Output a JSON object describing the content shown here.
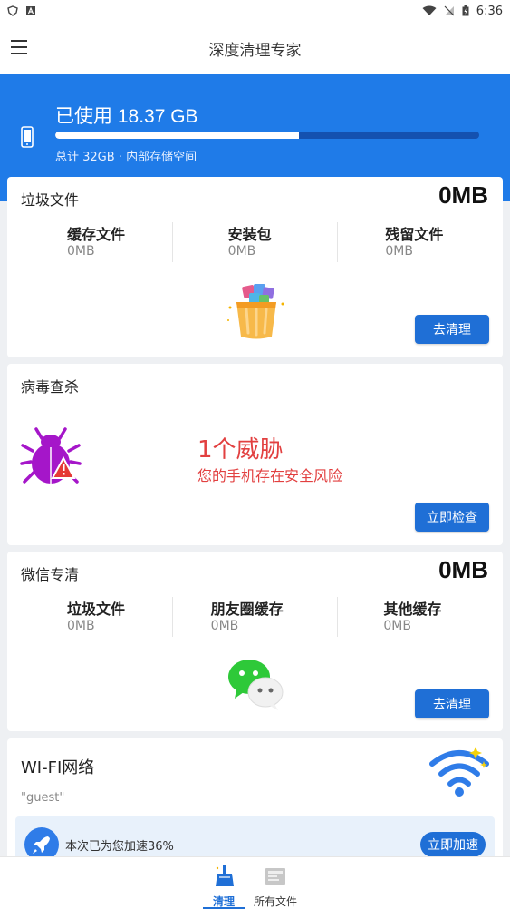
{
  "status_bar": {
    "time": "6:36"
  },
  "app_bar": {
    "title": "深度清理专家"
  },
  "storage": {
    "used_label": "已使用 18.37 GB",
    "subtitle": "总计 32GB · 内部存储空间",
    "used_fraction": 0.574
  },
  "junk": {
    "title": "垃圾文件",
    "total": "0MB",
    "stats": [
      {
        "label": "缓存文件",
        "value": "0MB"
      },
      {
        "label": "安装包",
        "value": "0MB"
      },
      {
        "label": "残留文件",
        "value": "0MB"
      }
    ],
    "clean_button": "去清理"
  },
  "virus": {
    "title": "病毒查杀",
    "threat_count": "1个威胁",
    "threat_message": "您的手机存在安全风险",
    "check_button": "立即检查"
  },
  "wechat": {
    "title": "微信专清",
    "total": "0MB",
    "stats": [
      {
        "label": "垃圾文件",
        "value": "0MB"
      },
      {
        "label": "朋友圈缓存",
        "value": "0MB"
      },
      {
        "label": "其他缓存",
        "value": "0MB"
      }
    ],
    "clean_button": "去清理"
  },
  "wifi": {
    "title": "WI-FI网络",
    "ssid": "\"guest\"",
    "boost_text": "本次已为您加速36%",
    "boost_button": "立即加速"
  },
  "bottom_nav": {
    "items": [
      {
        "label": "清理",
        "active": true
      },
      {
        "label": "所有文件",
        "active": false
      }
    ]
  },
  "colors": {
    "primary": "#1f7be8",
    "button": "#1f6fd6",
    "danger": "#e24040",
    "bug": "#a516c9"
  }
}
